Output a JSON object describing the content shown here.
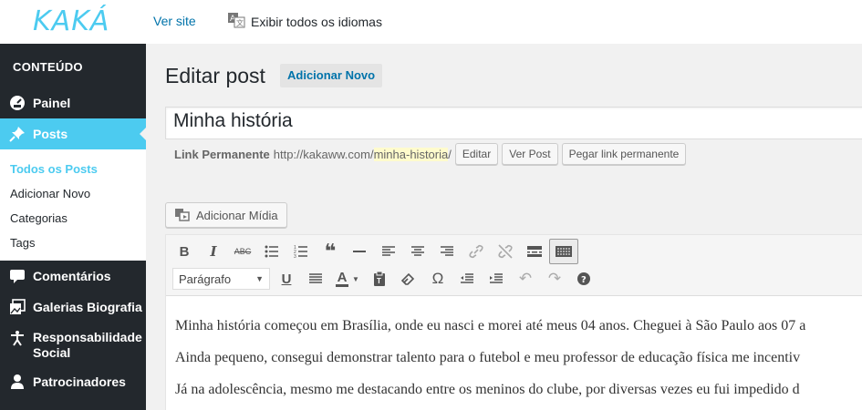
{
  "topbar": {
    "logo": "KAKÁ",
    "view_site": "Ver site",
    "languages": "Exibir todos os idiomas"
  },
  "sidebar": {
    "heading": "CONTEÚDO",
    "items": [
      {
        "label": "Painel",
        "icon": "dashboard-icon"
      },
      {
        "label": "Posts",
        "icon": "pin-icon",
        "active": true
      },
      {
        "label": "Comentários",
        "icon": "comment-icon"
      },
      {
        "label": "Galerias Biografia",
        "icon": "gallery-icon"
      },
      {
        "label": "Responsabilidade Social",
        "icon": "accessibility-icon"
      },
      {
        "label": "Patrocinadores",
        "icon": "user-icon"
      }
    ],
    "submenu": [
      "Todos os Posts",
      "Adicionar Novo",
      "Categorias",
      "Tags"
    ]
  },
  "main": {
    "title": "Editar post",
    "add_new": "Adicionar Novo",
    "post_title": "Minha história",
    "permalink": {
      "label": "Link Permanente",
      "base": "http://kakaww.com/",
      "slug": "minha-historia",
      "trail": "/",
      "edit": "Editar",
      "view": "Ver Post",
      "get": "Pegar link permanente"
    },
    "add_media": "Adicionar Mídia",
    "format": "Parágrafo",
    "paragraphs": [
      "Minha história começou em Brasília, onde eu nasci e morei até meus 04 anos. Cheguei à São Paulo aos 07 a",
      "Ainda pequeno, consegui demonstrar talento para o futebol e meu professor de educação física me incentiv",
      "Já na adolescência, mesmo me destacando entre os meninos do clube, por diversas vezes eu fui impedido d"
    ]
  },
  "colors": {
    "accent": "#4ccbf0",
    "sidebar": "#23282d",
    "link": "#0073aa"
  }
}
